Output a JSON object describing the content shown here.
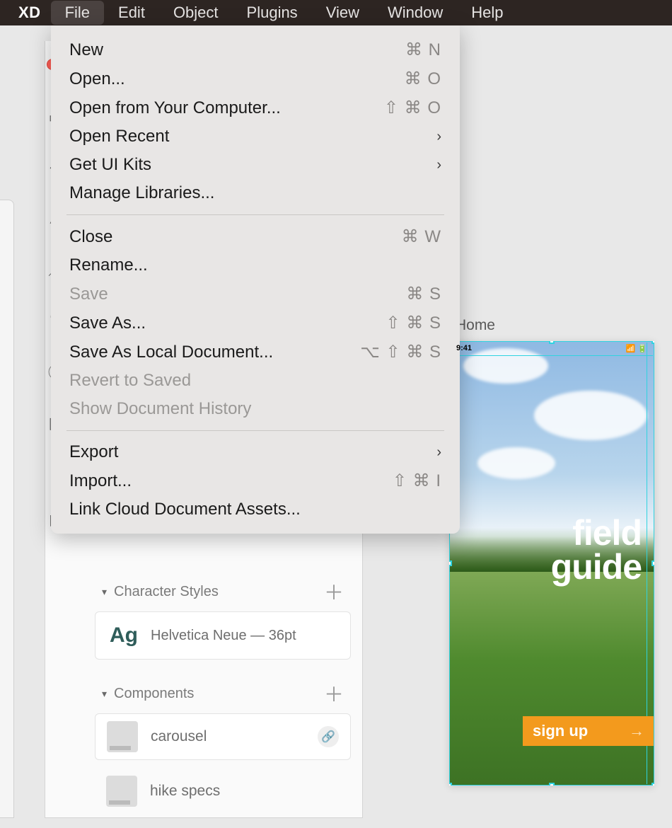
{
  "menubar": {
    "app": "XD",
    "items": [
      "File",
      "Edit",
      "Object",
      "Plugins",
      "View",
      "Window",
      "Help"
    ],
    "open_index": 0
  },
  "file_menu": [
    {
      "label": "New",
      "shortcut": "⌘ N"
    },
    {
      "label": "Open...",
      "shortcut": "⌘ O"
    },
    {
      "label": "Open from Your Computer...",
      "shortcut": "⇧ ⌘ O"
    },
    {
      "label": "Open Recent",
      "submenu": true
    },
    {
      "label": "Get UI Kits",
      "submenu": true
    },
    {
      "label": "Manage Libraries..."
    },
    {
      "sep": true
    },
    {
      "label": "Close",
      "shortcut": "⌘ W"
    },
    {
      "label": "Rename..."
    },
    {
      "label": "Save",
      "shortcut": "⌘ S",
      "disabled": true
    },
    {
      "label": "Save As...",
      "shortcut": "⇧ ⌘ S"
    },
    {
      "label": "Save As Local Document...",
      "shortcut": "⌥ ⇧ ⌘ S"
    },
    {
      "label": "Revert to Saved",
      "disabled": true
    },
    {
      "label": "Show Document History",
      "disabled": true
    },
    {
      "sep": true
    },
    {
      "label": "Export",
      "submenu": true
    },
    {
      "label": "Import...",
      "shortcut": "⇧ ⌘ I"
    },
    {
      "label": "Link Cloud Document Assets..."
    }
  ],
  "panel": {
    "char_styles_heading": "Character Styles",
    "font_sample": "Ag",
    "font_label": "Helvetica Neue — 36pt",
    "components_heading": "Components",
    "components": [
      {
        "label": "carousel",
        "linked": true
      },
      {
        "label": "hike specs"
      }
    ]
  },
  "canvas": {
    "artboard_label": "Home",
    "statusbar_time": "9:41",
    "title_line1": "field",
    "title_line2": "guide",
    "signup_label": "sign up"
  }
}
